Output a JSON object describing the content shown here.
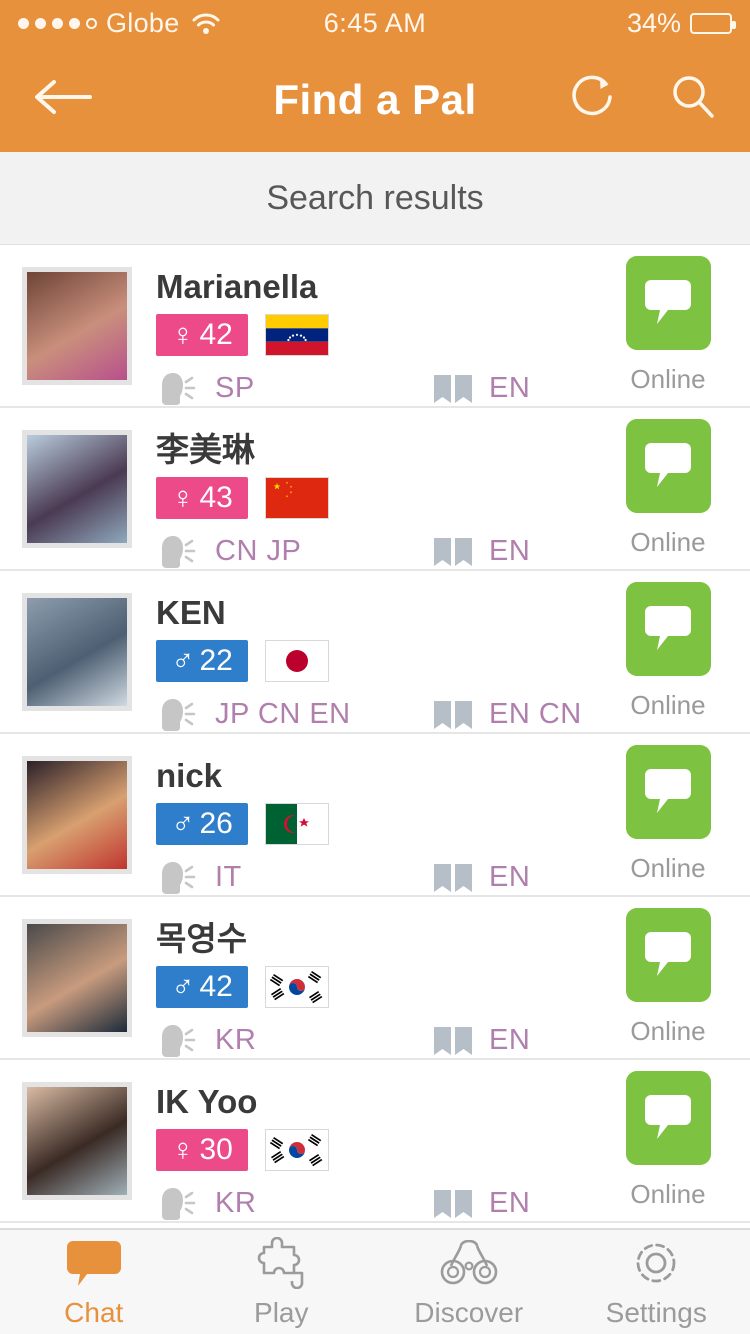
{
  "status_bar": {
    "signal_dots_filled": 4,
    "signal_dots_total": 5,
    "carrier": "Globe",
    "wifi_icon": "wifi-icon",
    "time": "6:45 AM",
    "battery_percent": "34%",
    "battery_level": 34
  },
  "header": {
    "back_icon": "back-arrow-icon",
    "title": "Find a Pal",
    "refresh_icon": "refresh-icon",
    "search_icon": "search-icon",
    "background_color": "#E8913C"
  },
  "section": {
    "title": "Search results"
  },
  "colors": {
    "accent_orange": "#E8913C",
    "female_badge": "#EC4A88",
    "male_badge": "#2F7ECB",
    "chat_green": "#7EC242",
    "lang_text": "#B07FAE",
    "name_text": "#3A3A3A",
    "status_text": "#9A9A9A"
  },
  "list": {
    "speak_icon": "speaking-head-icon",
    "learn_icon": "open-book-icon",
    "chat_icon": "chat-bubble-icon",
    "users": [
      {
        "name": "Marianella",
        "gender": "female",
        "gender_symbol": "♀",
        "age": "42",
        "country": "venezuela",
        "speaks": "SP",
        "learns": "EN",
        "status": "Online",
        "avatar_colors": [
          "#6e4436",
          "#c98f7c",
          "#b8508c"
        ]
      },
      {
        "name": "李美琳",
        "gender": "female",
        "gender_symbol": "♀",
        "age": "43",
        "country": "china",
        "speaks": "CN JP",
        "learns": "EN",
        "status": "Online",
        "avatar_colors": [
          "#b9cddd",
          "#4a3a52",
          "#8fa8bd"
        ]
      },
      {
        "name": "KEN",
        "gender": "male",
        "gender_symbol": "♂",
        "age": "22",
        "country": "japan",
        "speaks": "JP CN EN",
        "learns": "EN CN",
        "status": "Online",
        "avatar_colors": [
          "#8d9dae",
          "#4d5f72",
          "#cfd9e2"
        ]
      },
      {
        "name": "nick",
        "gender": "male",
        "gender_symbol": "♂",
        "age": "26",
        "country": "algeria",
        "speaks": "IT",
        "learns": "EN",
        "status": "Online",
        "avatar_colors": [
          "#2b2029",
          "#d8a070",
          "#c0352f"
        ]
      },
      {
        "name": "목영수",
        "gender": "male",
        "gender_symbol": "♂",
        "age": "42",
        "country": "south-korea",
        "speaks": "KR",
        "learns": "EN",
        "status": "Online",
        "avatar_colors": [
          "#4a4a4a",
          "#c89b7e",
          "#1d2b3a"
        ]
      },
      {
        "name": "IK Yoo",
        "gender": "female",
        "gender_symbol": "♀",
        "age": "30",
        "country": "south-korea",
        "speaks": "KR",
        "learns": "EN",
        "status": "Online",
        "avatar_colors": [
          "#d9bba4",
          "#3a2a24",
          "#9fb0b8"
        ]
      }
    ]
  },
  "tabbar": {
    "tabs": [
      {
        "label": "Chat",
        "icon": "chat-bubble-icon",
        "active": true
      },
      {
        "label": "Play",
        "icon": "puzzle-piece-icon",
        "active": false
      },
      {
        "label": "Discover",
        "icon": "binoculars-icon",
        "active": false
      },
      {
        "label": "Settings",
        "icon": "gear-icon",
        "active": false
      }
    ]
  }
}
